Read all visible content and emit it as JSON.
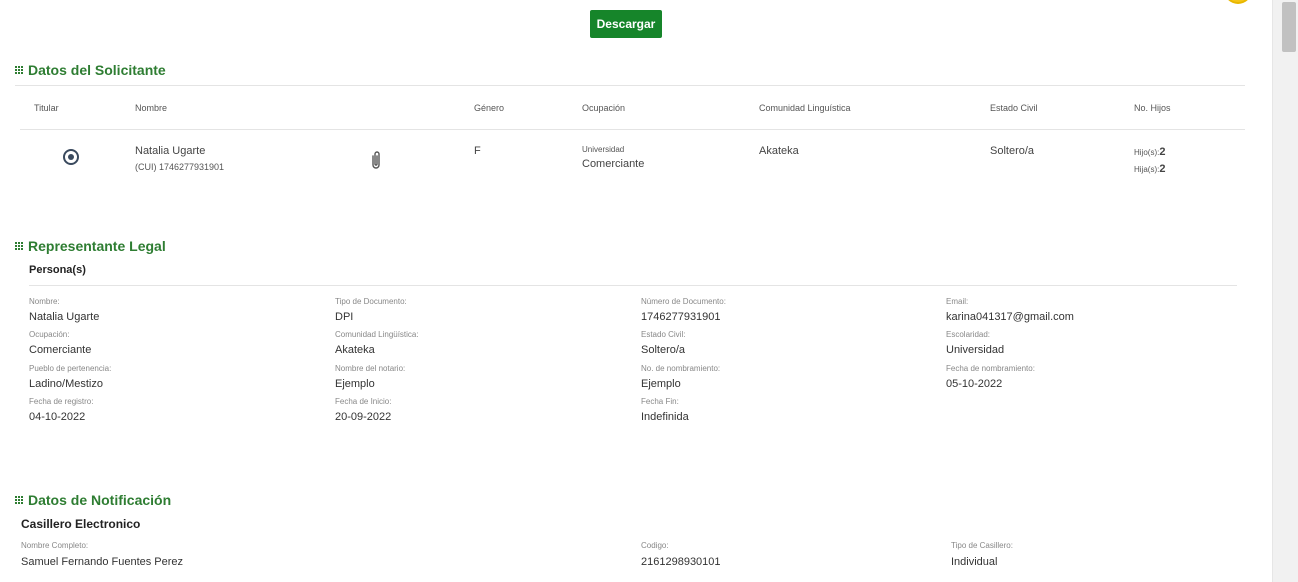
{
  "download_button": "Descargar",
  "solicitante": {
    "title": "Datos del Solicitante",
    "headers": {
      "titular": "Titular",
      "nombre": "Nombre",
      "genero": "Género",
      "ocupacion": "Ocupación",
      "comunidad": "Comunidad Linguística",
      "estado_civil": "Estado Civil",
      "hijos": "No. Hijos"
    },
    "row": {
      "nombre": "Natalia Ugarte",
      "cui": "(CUI) 1746277931901",
      "genero": "F",
      "escolaridad": "Universidad",
      "ocupacion": "Comerciante",
      "comunidad": "Akateka",
      "estado_civil": "Soltero/a",
      "hijos_label": "Hijo(s):",
      "hijos": "2",
      "hijas_label": "Hija(s):",
      "hijas": "2"
    }
  },
  "representante": {
    "title": "Representante Legal",
    "subtitle": "Persona(s)",
    "fields": [
      {
        "label": "Nombre:",
        "value": "Natalia Ugarte"
      },
      {
        "label": "Tipo de Documento:",
        "value": "DPI"
      },
      {
        "label": "Número de Documento:",
        "value": "1746277931901"
      },
      {
        "label": "Email:",
        "value": "karina041317@gmail.com"
      },
      {
        "label": "Ocupación:",
        "value": "Comerciante"
      },
      {
        "label": "Comunidad Lingüística:",
        "value": "Akateka"
      },
      {
        "label": "Estado Civil:",
        "value": "Soltero/a"
      },
      {
        "label": "Escolaridad:",
        "value": "Universidad"
      },
      {
        "label": "Pueblo de pertenencia:",
        "value": "Ladino/Mestizo"
      },
      {
        "label": "Nombre del notario:",
        "value": "Ejemplo"
      },
      {
        "label": "No. de nombramiento:",
        "value": "Ejemplo"
      },
      {
        "label": "Fecha de nombramiento:",
        "value": "05-10-2022"
      },
      {
        "label": "Fecha de registro:",
        "value": "04-10-2022"
      },
      {
        "label": "Fecha de Inicio:",
        "value": "20-09-2022"
      },
      {
        "label": "Fecha Fin:",
        "value": "Indefinida"
      }
    ]
  },
  "notificacion": {
    "title": "Datos de Notificación",
    "subtitle": "Casillero Electronico",
    "fields": [
      {
        "label": "Nombre Completo:",
        "value": "Samuel Fernando Fuentes Perez"
      },
      {
        "label": "Codigo:",
        "value": "2161298930101"
      },
      {
        "label": "Tipo de Casillero:",
        "value": "Individual"
      }
    ]
  },
  "colors": {
    "accent": "#2e7d32",
    "button": "#16852a"
  }
}
